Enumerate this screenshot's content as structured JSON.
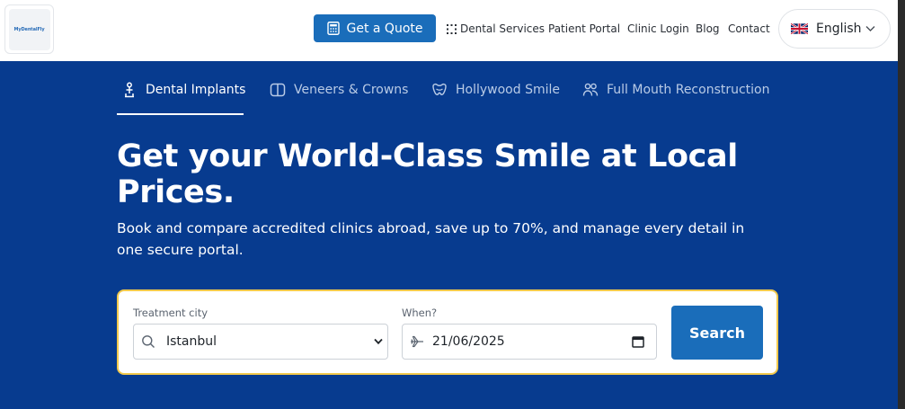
{
  "header": {
    "logo_text": "MyDentalFly",
    "quote_label": "Get a Quote",
    "nav": {
      "services": "Dental Services",
      "patient_portal": "Patient Portal",
      "clinic_login": "Clinic Login",
      "blog": "Blog",
      "contact": "Contact"
    },
    "language": "English"
  },
  "tabs": [
    {
      "label": "Dental Implants",
      "icon": "implant-icon",
      "active": true
    },
    {
      "label": "Veneers & Crowns",
      "icon": "veneer-icon",
      "active": false
    },
    {
      "label": "Hollywood Smile",
      "icon": "smile-icon",
      "active": false
    },
    {
      "label": "Full Mouth Reconstruction",
      "icon": "users-icon",
      "active": false
    }
  ],
  "hero": {
    "title": "Get your World-Class Smile at Local Prices.",
    "subtitle": "Book and compare accredited clinics abroad, save up to 70%, and manage every detail in one secure portal."
  },
  "search": {
    "city_label": "Treatment city",
    "city_value": "Istanbul",
    "when_label": "When?",
    "when_value": "21/06/2025",
    "button_label": "Search"
  },
  "colors": {
    "brand_blue": "#1a6dba",
    "hero_bg": "#073b8f",
    "card_border": "#f2c94c"
  }
}
